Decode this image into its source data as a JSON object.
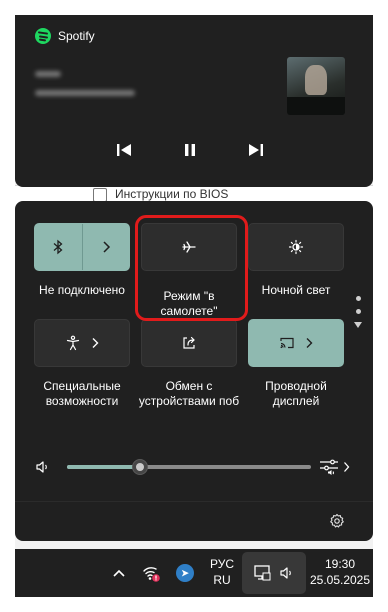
{
  "background_doc": {
    "checkbox_label": "Инструкции по BIOS"
  },
  "media": {
    "app_name": "Spotify",
    "icons": [
      "spotify-logo",
      "previous-track-icon",
      "pause-icon",
      "next-track-icon"
    ]
  },
  "quick_settings": {
    "tiles": [
      {
        "label": "Не подключено",
        "icon": "bluetooth-icon",
        "active": true
      },
      {
        "label": "Режим \"в самолете\"",
        "icon": "airplane-icon",
        "active": false
      },
      {
        "label": "Ночной свет",
        "icon": "night-light-icon",
        "active": false
      },
      {
        "label": "Специальные возможности",
        "icon": "accessibility-icon",
        "active": false
      },
      {
        "label": "Обмен с устройствами поб",
        "icon": "share-icon",
        "active": false
      },
      {
        "label": "Проводной дисплей",
        "icon": "cast-icon",
        "active": true
      }
    ],
    "volume": {
      "level_fraction": 0.3,
      "icon": "speaker-icon"
    },
    "settings_icon": "gear-icon"
  },
  "taskbar": {
    "lang_line1": "РУС",
    "lang_line2": "RU",
    "time": "19:30",
    "date": "25.05.2025"
  },
  "colors": {
    "accent": "#8fb9b0",
    "panel": "#202020",
    "tile": "#2d2d2d",
    "highlight": "#e11b1b",
    "spotify": "#1ed760"
  }
}
